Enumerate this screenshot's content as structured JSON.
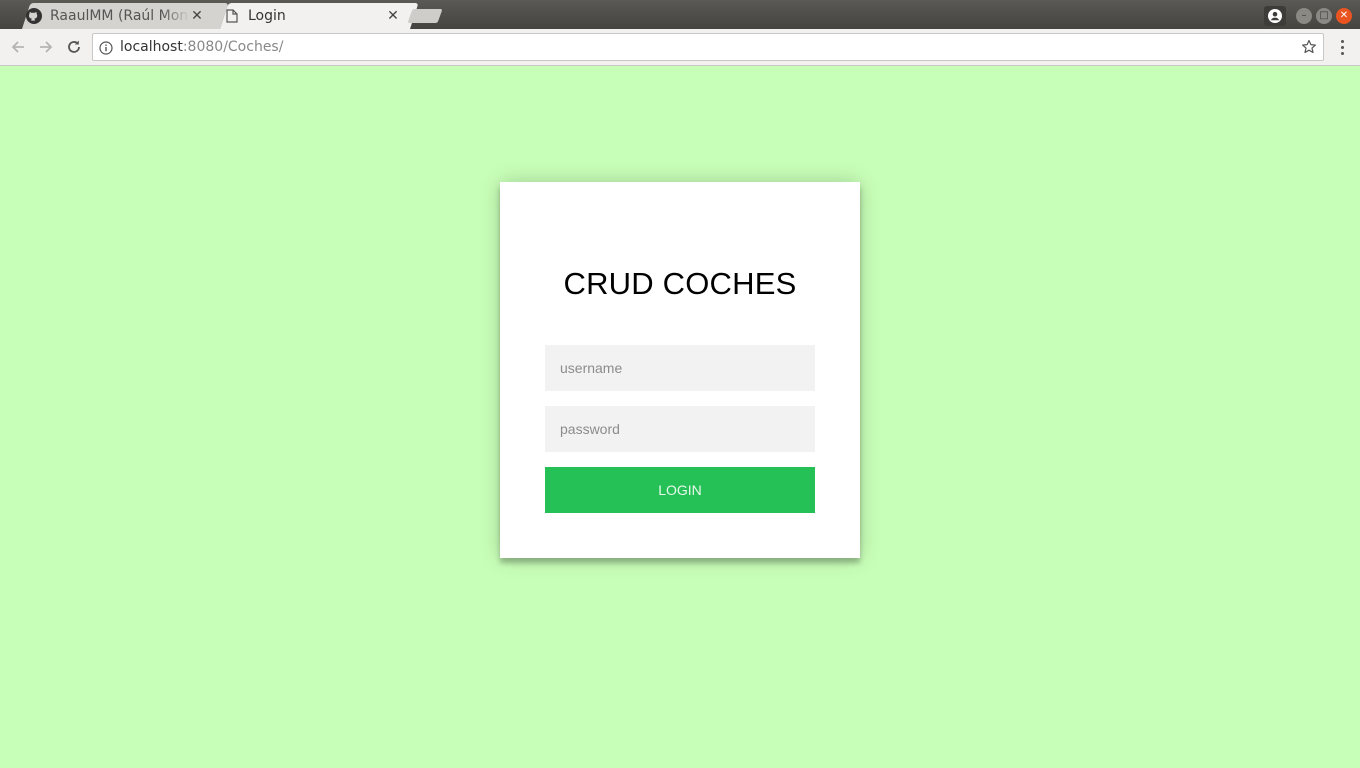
{
  "browser": {
    "tabs": [
      {
        "title": "RaaulMM (Raúl Mon",
        "favicon": "github-icon",
        "active": false
      },
      {
        "title": "Login",
        "favicon": "document-icon",
        "active": true
      }
    ],
    "url_host": "localhost",
    "url_rest": ":8080/Coches/"
  },
  "login": {
    "title": "CRUD COCHES",
    "username_placeholder": "username",
    "password_placeholder": "password",
    "button_label": "LOGIN"
  },
  "colors": {
    "page_background": "#c8ffb8",
    "card_background": "#ffffff",
    "input_background": "#f2f2f2",
    "button_background": "#25c157",
    "window_close": "#e95420"
  }
}
